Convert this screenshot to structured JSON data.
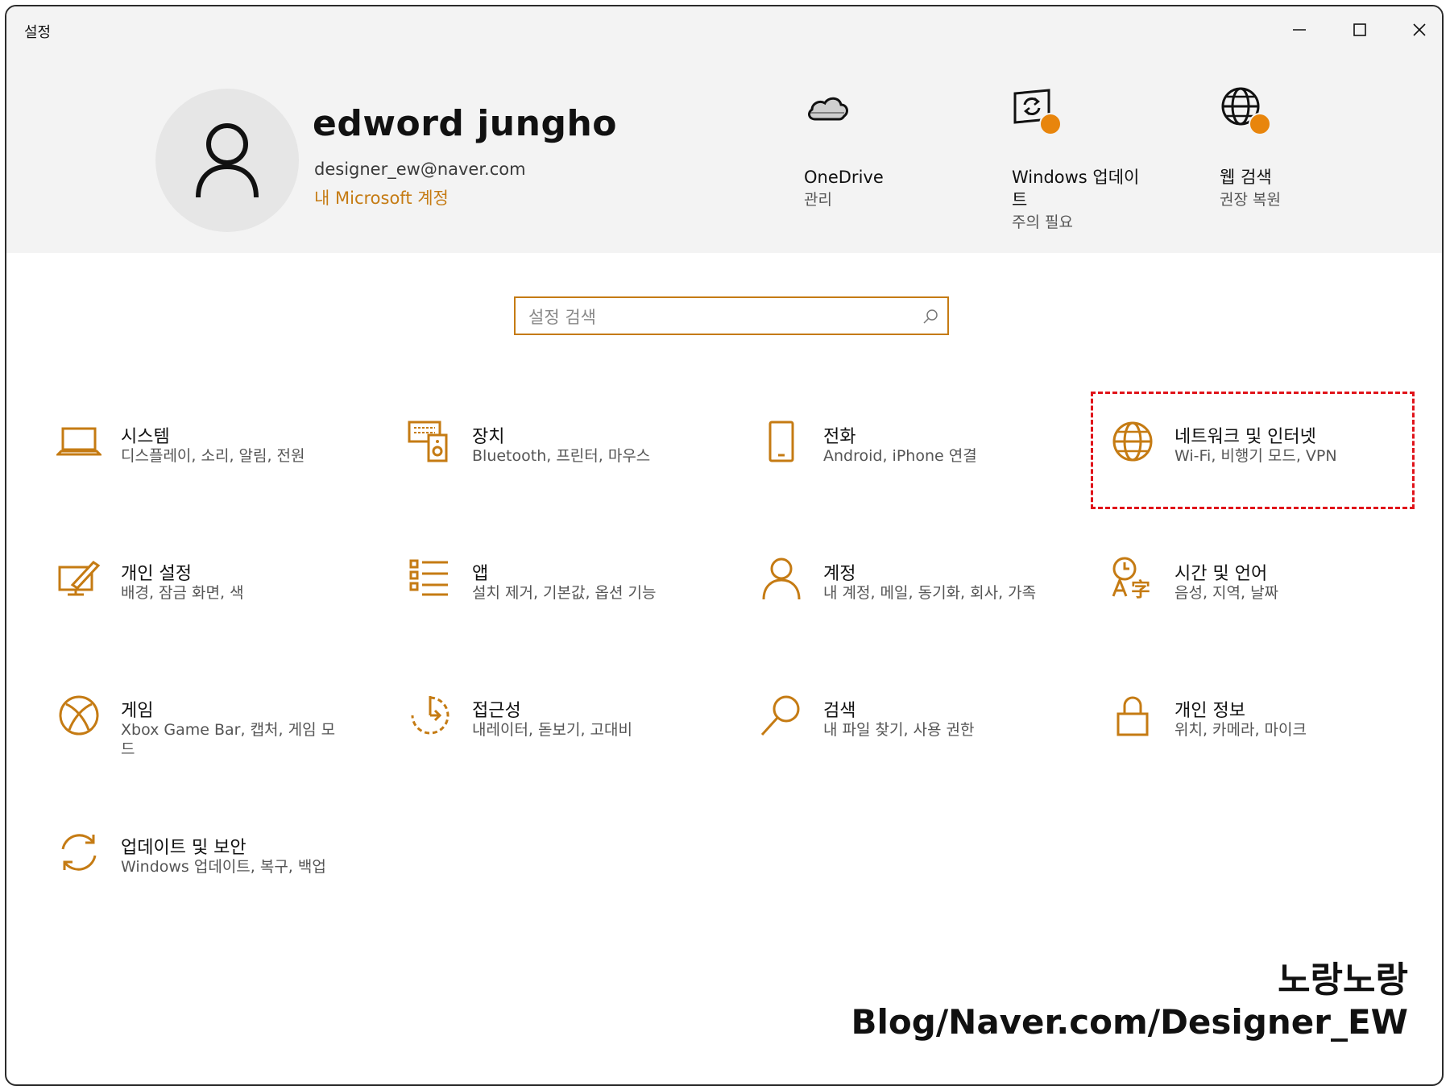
{
  "window": {
    "title": "설정",
    "minimize_icon": "minimize-icon",
    "maximize_icon": "maximize-icon",
    "close_icon": "close-icon"
  },
  "user": {
    "name": "edword jungho",
    "email": "designer_ew@naver.com",
    "account_link": "내 Microsoft 계정"
  },
  "header_tiles": [
    {
      "title": "OneDrive",
      "title2": "",
      "subtitle": "관리",
      "icon": "cloud-icon"
    },
    {
      "title": "Windows 업데이",
      "title2": "트",
      "subtitle": "주의 필요",
      "icon": "windows-update-icon"
    },
    {
      "title": "웹 검색",
      "title2": "",
      "subtitle": "권장 복원",
      "icon": "globe-icon"
    }
  ],
  "search": {
    "placeholder": "설정 검색"
  },
  "categories": [
    {
      "title": "시스템",
      "subtitle": "디스플레이, 소리, 알림, 전원",
      "icon": "laptop-icon"
    },
    {
      "title": "장치",
      "subtitle": "Bluetooth, 프린터, 마우스",
      "icon": "devices-icon"
    },
    {
      "title": "전화",
      "subtitle": "Android, iPhone 연결",
      "icon": "phone-icon"
    },
    {
      "title": "네트워크 및 인터넷",
      "subtitle": "Wi-Fi, 비행기 모드, VPN",
      "icon": "globe-icon"
    },
    {
      "title": "개인 설정",
      "subtitle": "배경, 잠금 화면, 색",
      "icon": "personalization-icon"
    },
    {
      "title": "앱",
      "subtitle": "설치 제거, 기본값, 옵션 기능",
      "icon": "apps-list-icon"
    },
    {
      "title": "계정",
      "subtitle": "내 계정, 메일, 동기화, 회사, 가족",
      "icon": "person-icon"
    },
    {
      "title": "시간 및 언어",
      "subtitle": "음성, 지역, 날짜",
      "icon": "time-language-icon"
    },
    {
      "title": "게임",
      "subtitle": "Xbox Game Bar, 캡처, 게임 모드",
      "icon": "xbox-icon"
    },
    {
      "title": "접근성",
      "subtitle": "내레이터, 돋보기, 고대비",
      "icon": "accessibility-icon"
    },
    {
      "title": "검색",
      "subtitle": "내 파일 찾기, 사용 권한",
      "icon": "search-icon"
    },
    {
      "title": "개인 정보",
      "subtitle": "위치, 카메라, 마이크",
      "icon": "lock-icon"
    },
    {
      "title": "업데이트 및 보안",
      "subtitle": "Windows 업데이트, 복구, 백업",
      "icon": "update-sync-icon"
    }
  ],
  "watermark": {
    "line1": "노랑노랑",
    "line2": "Blog/Naver.com/Designer_EW"
  },
  "colors": {
    "accent": "#c57b13",
    "badge": "#e8850c",
    "highlight": "#e0131a"
  }
}
